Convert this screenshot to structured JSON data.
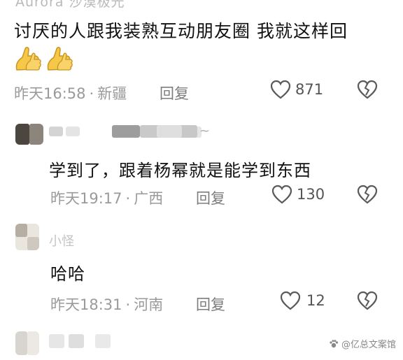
{
  "top_comment": {
    "username_partial": "Aurora 沙漠极光",
    "text": "讨厌的人跟我装熟互动朋友圈 我就这样回",
    "emoji_icons": [
      "thumbs-up-icon",
      "thumbs-up-icon"
    ],
    "time": "昨天16:58",
    "location": "新疆",
    "reply_label": "回复",
    "like_count": "871"
  },
  "replies": [
    {
      "username_suffix": "~",
      "text": "学到了，跟着杨幂就是能学到东西",
      "time": "昨天19:17",
      "location": "广西",
      "reply_label": "回复",
      "like_count": "130"
    },
    {
      "username": "小怪",
      "text": "哈哈",
      "time": "昨天18:31",
      "location": "河南",
      "reply_label": "回复",
      "like_count": "12"
    }
  ],
  "separator": "·",
  "watermark": "@亿总文案馆",
  "colors": {
    "text": "#111111",
    "meta": "#9a9a9a",
    "icon": "#5a5a5a",
    "emoji_fill": "#f5c84a"
  }
}
